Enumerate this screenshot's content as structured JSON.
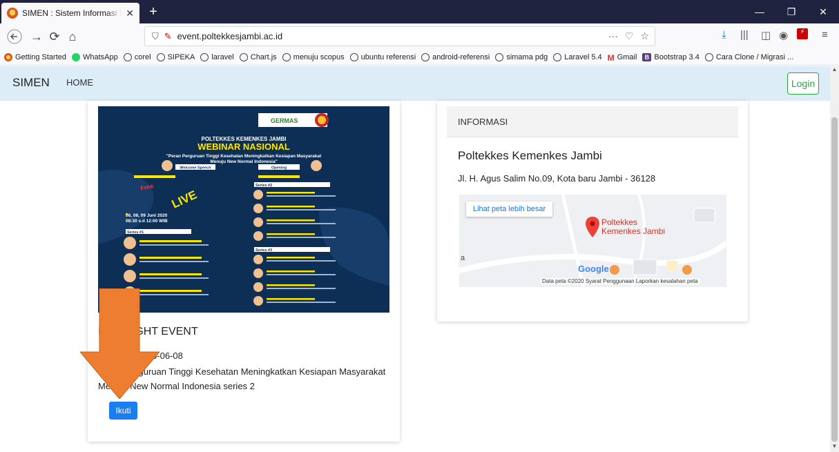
{
  "browser": {
    "tab_title": "SIMEN : Sistem Informasi Manajemen Event",
    "url": "event.poltekkesjambi.ac.id",
    "url_more": "···"
  },
  "bookmarks": [
    {
      "label": "Getting Started",
      "icon": "firefox-icon"
    },
    {
      "label": "WhatsApp",
      "icon": "whatsapp-icon"
    },
    {
      "label": "corel",
      "icon": "globe-icon"
    },
    {
      "label": "SIPEKA",
      "icon": "globe-icon"
    },
    {
      "label": "laravel",
      "icon": "globe-icon"
    },
    {
      "label": "Chart.js",
      "icon": "globe-icon"
    },
    {
      "label": "menuju scopus",
      "icon": "globe-icon"
    },
    {
      "label": "ubuntu referensi",
      "icon": "globe-icon"
    },
    {
      "label": "android-referensi",
      "icon": "globe-icon"
    },
    {
      "label": "simama pdg",
      "icon": "globe-icon"
    },
    {
      "label": "Laravel 5.4",
      "icon": "globe-icon"
    },
    {
      "label": "Gmail",
      "icon": "gmail-icon"
    },
    {
      "label": "Bootstrap 3.4",
      "icon": "bootstrap-icon"
    },
    {
      "label": "Cara Clone / Migrasi ...",
      "icon": "globe-icon"
    }
  ],
  "site": {
    "brand": "SIMEN",
    "home": "HOME",
    "login": "Login"
  },
  "event": {
    "title": "HIGHLIGHT EVENT",
    "date_line": "Tanggal : 2020-06-08",
    "description": "Peran Perguruan Tinggi Kesehatan Meningkatkan Kesiapan Masyarakat Menuju New Normal Indonesia series 2",
    "join": "Ikuti",
    "poster": {
      "org": "POLTEKKES KEMENKES JAMBI",
      "headline": "WEBINAR NASIONAL",
      "subhead": "\"Peran Perguruan Tinggi Kesehatan Meningkatkan Kesiapan Masyarakat Menuju New Normal Indonesia\"",
      "welcome": "Welcome Speech",
      "opening": "Opening",
      "free": "Free",
      "live": "LIVE",
      "dates": "06, 08, 09 Juni 2020",
      "time": "08:30 s.d 12:00 WIB",
      "germas": "GERMAS",
      "series1": "Series #1",
      "series2": "Series #2",
      "series3": "Series #3"
    }
  },
  "info": {
    "header": "INFORMASI",
    "org": "Poltekkes Kemenkes Jambi",
    "address": "Jl. H. Agus Salim No.09, Kota baru Jambi - 36128",
    "map": {
      "bigger": "Lihat peta lebih besar",
      "pin_line1": "Poltekkes",
      "pin_line2": "Kemenkes Jambi",
      "google": "Google",
      "attribution": "Data peta ©2020   Syarat Penggunaan   Laporkan kesalahan peta",
      "letter": "a"
    }
  },
  "colors": {
    "navbar_bg": "#ddedf8",
    "login_green": "#28a745",
    "button_blue": "#1a7ef1",
    "arrow_orange": "#ed7d31",
    "poster_bg": "#0e2f55"
  }
}
